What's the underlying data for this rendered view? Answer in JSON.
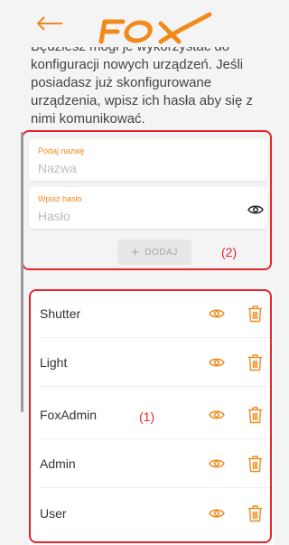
{
  "header": {
    "back_icon": "arrow-left-icon",
    "logo_text": "FOX",
    "accent_color": "#f08a1c"
  },
  "intro_text": "Będziesz mógł je wykorzystać do konfiguracji nowych urządzeń. Jeśli posiadasz już skonfigurowane urządzenia, wpisz ich hasła aby się z nimi komunikować.",
  "form": {
    "name_field": {
      "label": "Podaj nazwę",
      "placeholder": "Nazwa"
    },
    "password_field": {
      "label": "Wpisz hasło",
      "placeholder": "Hasło",
      "icon": "eye-icon"
    },
    "add_button": {
      "icon": "plus-icon",
      "label": "DODAJ"
    },
    "region_label": "(2)"
  },
  "devices": {
    "region_label": "(1)",
    "items": [
      {
        "name": "Shutter"
      },
      {
        "name": "Light"
      },
      {
        "name": "FoxAdmin"
      },
      {
        "name": "Admin"
      },
      {
        "name": "User"
      }
    ],
    "row_icons": [
      "eye-icon",
      "trash-icon"
    ]
  },
  "colors": {
    "annotation_red": "#e2262c",
    "accent_orange": "#f08a1c",
    "background": "#f4f4f4"
  }
}
